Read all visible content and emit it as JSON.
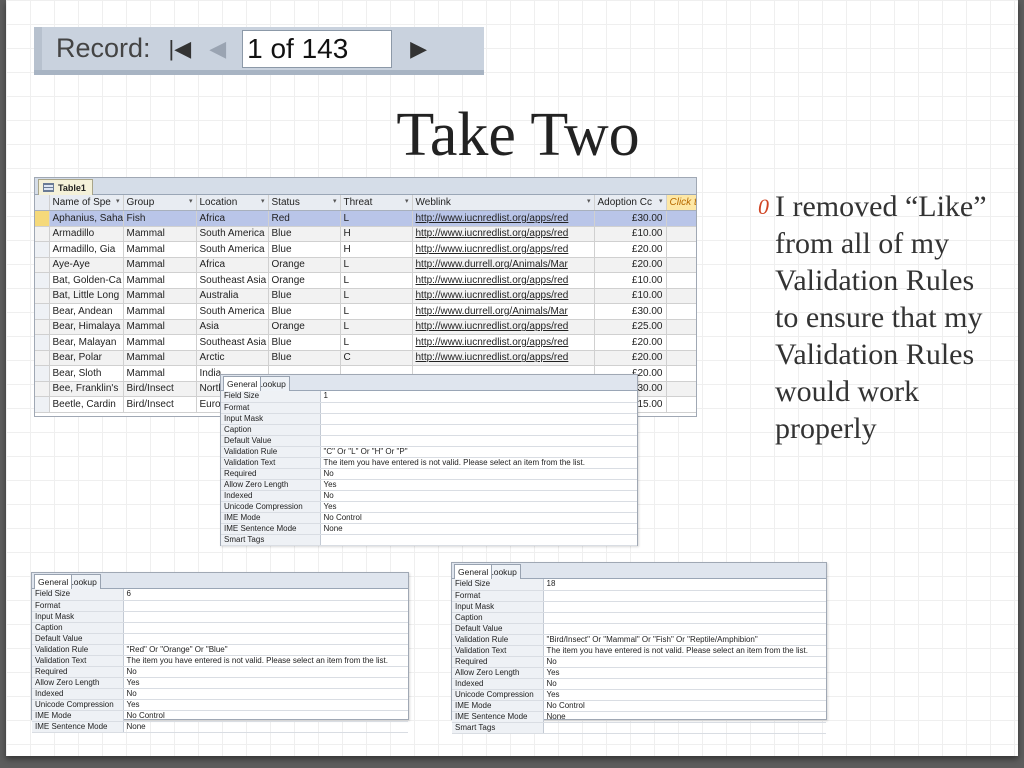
{
  "navigator": {
    "label": "Record:",
    "first_icon": "first-record-icon",
    "prev_icon": "previous-record-icon",
    "next_icon": "next-record-icon",
    "position": "1 of 143"
  },
  "slide": {
    "title": "Take Two",
    "bullet_icon": "0",
    "bullet_text": "I removed “Like” from all of my Validation Rules to ensure that my Validation Rules would work properly"
  },
  "table": {
    "tab_label": "Table1",
    "columns": [
      "Name of Spe",
      "Group",
      "Location",
      "Status",
      "Threat",
      "Weblink",
      "Adoption Cc",
      "Click t"
    ],
    "rows": [
      [
        "Aphanius, Saha",
        "Fish",
        "Africa",
        "Red",
        "L",
        "http://www.iucnredlist.org/apps/red",
        "£30.00"
      ],
      [
        "Armadillo",
        "Mammal",
        "South America",
        "Blue",
        "H",
        "http://www.iucnredlist.org/apps/red",
        "£10.00"
      ],
      [
        "Armadillo, Gia",
        "Mammal",
        "South America",
        "Blue",
        "H",
        "http://www.iucnredlist.org/apps/red",
        "£20.00"
      ],
      [
        "Aye-Aye",
        "Mammal",
        "Africa",
        "Orange",
        "L",
        "http://www.durrell.org/Animals/Mar",
        "£20.00"
      ],
      [
        "Bat, Golden-Ca",
        "Mammal",
        "Southeast Asia",
        "Orange",
        "L",
        "http://www.iucnredlist.org/apps/red",
        "£10.00"
      ],
      [
        "Bat, Little Long",
        "Mammal",
        "Australia",
        "Blue",
        "L",
        "http://www.iucnredlist.org/apps/red",
        "£10.00"
      ],
      [
        "Bear, Andean",
        "Mammal",
        "South America",
        "Blue",
        "L",
        "http://www.durrell.org/Animals/Mar",
        "£30.00"
      ],
      [
        "Bear, Himalaya",
        "Mammal",
        "Asia",
        "Orange",
        "L",
        "http://www.iucnredlist.org/apps/red",
        "£25.00"
      ],
      [
        "Bear, Malayan",
        "Mammal",
        "Southeast Asia",
        "Blue",
        "L",
        "http://www.iucnredlist.org/apps/red",
        "£20.00"
      ],
      [
        "Bear, Polar",
        "Mammal",
        "Arctic",
        "Blue",
        "C",
        "http://www.iucnredlist.org/apps/red",
        "£20.00"
      ],
      [
        "Bear, Sloth",
        "Mammal",
        "India",
        "",
        "",
        "",
        "£20.00"
      ],
      [
        "Bee, Franklin's",
        "Bird/Insect",
        "North",
        "",
        "",
        "",
        "£30.00"
      ],
      [
        "Beetle, Cardin",
        "Bird/Insect",
        "Europ",
        "",
        "",
        "",
        "£15.00"
      ]
    ]
  },
  "panels": {
    "threat": {
      "tabs": [
        "General",
        "Lookup"
      ],
      "props": [
        [
          "Field Size",
          "1"
        ],
        [
          "Format",
          ""
        ],
        [
          "Input Mask",
          ""
        ],
        [
          "Caption",
          ""
        ],
        [
          "Default Value",
          ""
        ],
        [
          "Validation Rule",
          "\"C\" Or \"L\" Or \"H\" Or \"P\""
        ],
        [
          "Validation Text",
          "The item you have entered is not valid. Please select an item from the list."
        ],
        [
          "Required",
          "No"
        ],
        [
          "Allow Zero Length",
          "Yes"
        ],
        [
          "Indexed",
          "No"
        ],
        [
          "Unicode Compression",
          "Yes"
        ],
        [
          "IME Mode",
          "No Control"
        ],
        [
          "IME Sentence Mode",
          "None"
        ],
        [
          "Smart Tags",
          ""
        ]
      ]
    },
    "status": {
      "tabs": [
        "General",
        "Lookup"
      ],
      "props": [
        [
          "Field Size",
          "6"
        ],
        [
          "Format",
          ""
        ],
        [
          "Input Mask",
          ""
        ],
        [
          "Caption",
          ""
        ],
        [
          "Default Value",
          ""
        ],
        [
          "Validation Rule",
          "\"Red\" Or \"Orange\" Or \"Blue\""
        ],
        [
          "Validation Text",
          "The item you have entered is not valid. Please select an item from the list."
        ],
        [
          "Required",
          "No"
        ],
        [
          "Allow Zero Length",
          "Yes"
        ],
        [
          "Indexed",
          "No"
        ],
        [
          "Unicode Compression",
          "Yes"
        ],
        [
          "IME Mode",
          "No Control"
        ],
        [
          "IME Sentence Mode",
          "None"
        ]
      ]
    },
    "group": {
      "tabs": [
        "General",
        "Lookup"
      ],
      "props": [
        [
          "Field Size",
          "18"
        ],
        [
          "Format",
          ""
        ],
        [
          "Input Mask",
          ""
        ],
        [
          "Caption",
          ""
        ],
        [
          "Default Value",
          ""
        ],
        [
          "Validation Rule",
          "\"Bird/Insect\" Or \"Mammal\" Or \"Fish\" Or \"Reptile/Amphibion\""
        ],
        [
          "Validation Text",
          "The item you have entered is not valid. Please select an item from the list."
        ],
        [
          "Required",
          "No"
        ],
        [
          "Allow Zero Length",
          "Yes"
        ],
        [
          "Indexed",
          "No"
        ],
        [
          "Unicode Compression",
          "Yes"
        ],
        [
          "IME Mode",
          "No Control"
        ],
        [
          "IME Sentence Mode",
          "None"
        ],
        [
          "Smart Tags",
          ""
        ]
      ]
    }
  }
}
